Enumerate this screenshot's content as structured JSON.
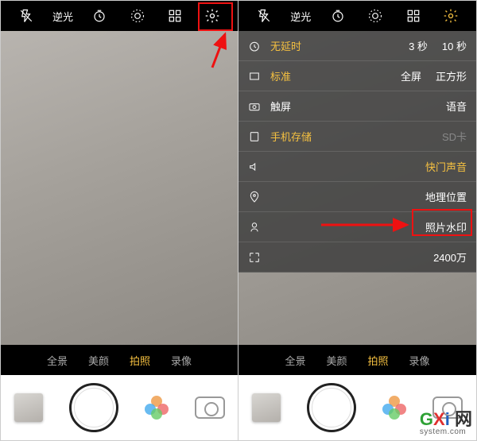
{
  "left": {
    "top": {
      "flash": "flash-off-icon",
      "backlight": "逆光",
      "timer": "timer-icon",
      "live": "live-icon",
      "grid": "grid-icon",
      "gear": "gear-icon"
    },
    "modes": {
      "m1": "全景",
      "m2": "美颜",
      "m3": "拍照",
      "m4": "录像"
    }
  },
  "right": {
    "top": {
      "flash": "flash-off-icon",
      "backlight": "逆光",
      "timer": "timer-icon",
      "live": "live-icon",
      "grid": "grid-icon",
      "gear": "gear-icon"
    },
    "modes": {
      "m1": "全景",
      "m2": "美颜",
      "m3": "拍照",
      "m4": "录像"
    },
    "settings": {
      "row0": {
        "o1": "无延时",
        "o2": "3 秒",
        "o3": "10 秒"
      },
      "row1": {
        "o1": "标准",
        "o2": "全屏",
        "o3": "正方形"
      },
      "row2": {
        "o1": "触屏",
        "o2": "语音"
      },
      "row3": {
        "o1": "手机存储",
        "o2": "SD卡"
      },
      "row4": {
        "label": "快门声音"
      },
      "row5": {
        "label": "地理位置"
      },
      "row6": {
        "label": "照片水印"
      },
      "row7": {
        "label": "2400万"
      }
    }
  },
  "watermark": {
    "brand": "GXi",
    "site": "网",
    "sub": "system.com"
  }
}
